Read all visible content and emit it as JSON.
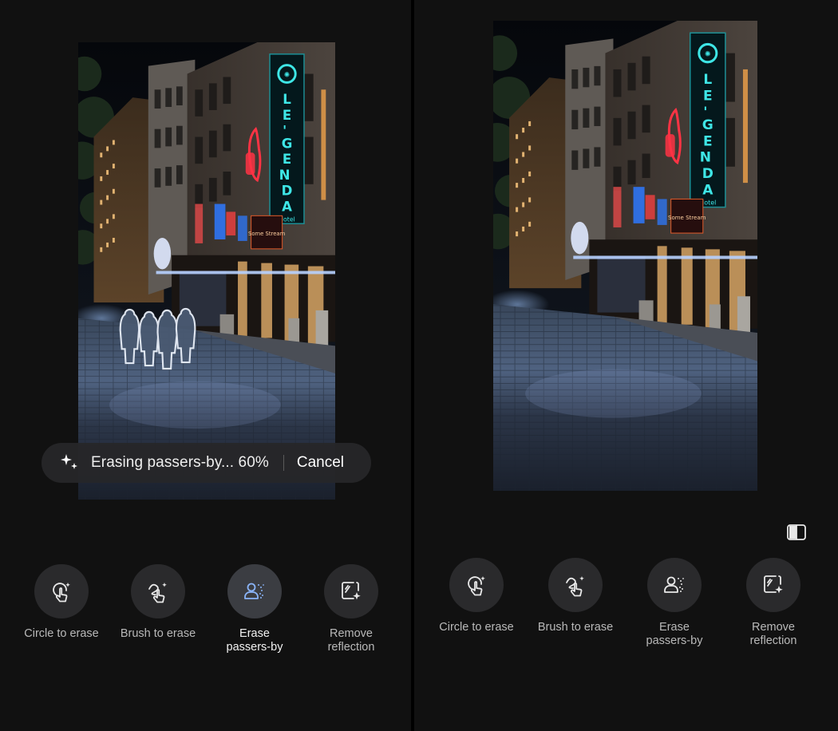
{
  "left_panel": {
    "progress": {
      "text": "Erasing passers-by... 60%",
      "cancel_label": "Cancel",
      "percent": 60
    },
    "tools": [
      {
        "label_line1": "Circle to erase",
        "label_line2": "",
        "icon": "circle-to-erase-icon",
        "active": false
      },
      {
        "label_line1": "Brush to erase",
        "label_line2": "",
        "icon": "brush-to-erase-icon",
        "active": false
      },
      {
        "label_line1": "Erase",
        "label_line2": "passers-by",
        "icon": "erase-passers-by-icon",
        "active": true
      },
      {
        "label_line1": "Remove",
        "label_line2": "reflection",
        "icon": "remove-reflection-icon",
        "active": false
      }
    ]
  },
  "right_panel": {
    "compare_icon": "compare-icon",
    "tools": [
      {
        "label_line1": "Circle to erase",
        "label_line2": "",
        "icon": "circle-to-erase-icon",
        "active": false
      },
      {
        "label_line1": "Brush to erase",
        "label_line2": "",
        "icon": "brush-to-erase-icon",
        "active": false
      },
      {
        "label_line1": "Erase",
        "label_line2": "passers-by",
        "icon": "erase-passers-by-icon",
        "active": false
      },
      {
        "label_line1": "Remove",
        "label_line2": "reflection",
        "icon": "remove-reflection-icon",
        "active": false
      }
    ]
  },
  "photo": {
    "sign_vertical_text": "LE'GENDA",
    "sign_small_text": "Hotel",
    "lower_sign_text": "Some Stream"
  },
  "colors": {
    "background": "#111111",
    "button_bg": "#2a2a2c",
    "active_icon": "#8ab4f8",
    "neon_cyan": "#3ee6e6",
    "neon_red": "#ff3344"
  }
}
